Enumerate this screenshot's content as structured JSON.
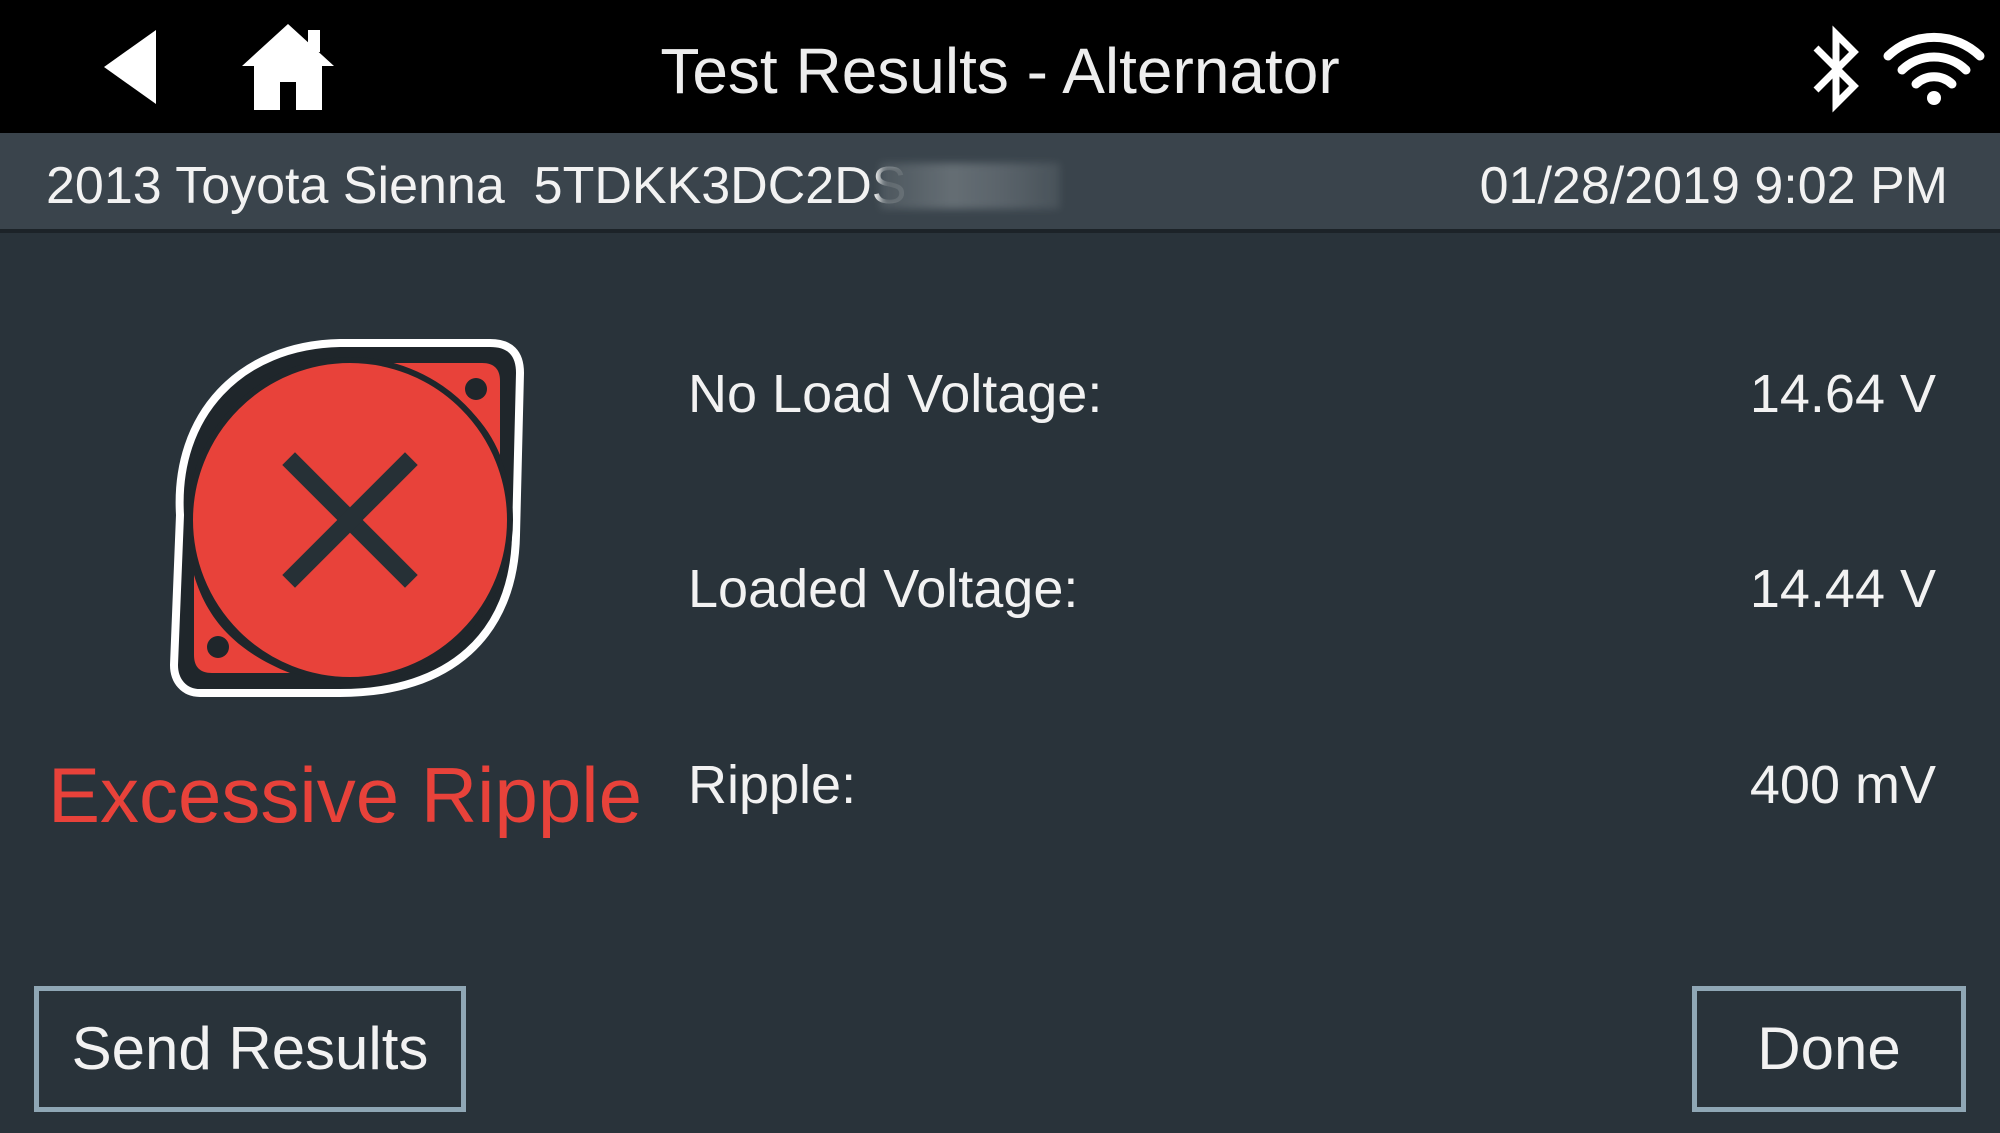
{
  "header": {
    "title": "Test Results - Alternator",
    "back_icon": "back-arrow-icon",
    "home_icon": "home-icon",
    "bluetooth_icon": "bluetooth-icon",
    "wifi_icon": "wifi-icon"
  },
  "vehicle": {
    "description": "2013 Toyota Sienna  5TDKK3DC2DS",
    "datetime": "01/28/2019 9:02 PM"
  },
  "result": {
    "status_label": "Excessive Ripple",
    "status_icon": "fail-x-icon",
    "status_color": "#e8423a"
  },
  "measurements": [
    {
      "label": "No Load Voltage:",
      "value": "14.64 V"
    },
    {
      "label": "Loaded Voltage:",
      "value": "14.44 V"
    },
    {
      "label": "Ripple:",
      "value": "400 mV"
    }
  ],
  "buttons": {
    "send_results": "Send Results",
    "done": "Done"
  },
  "colors": {
    "background": "#29333a",
    "header": "#000000",
    "info_bar": "#3a444c",
    "button_border": "#8fa7b5",
    "fail_red": "#e8423a"
  }
}
